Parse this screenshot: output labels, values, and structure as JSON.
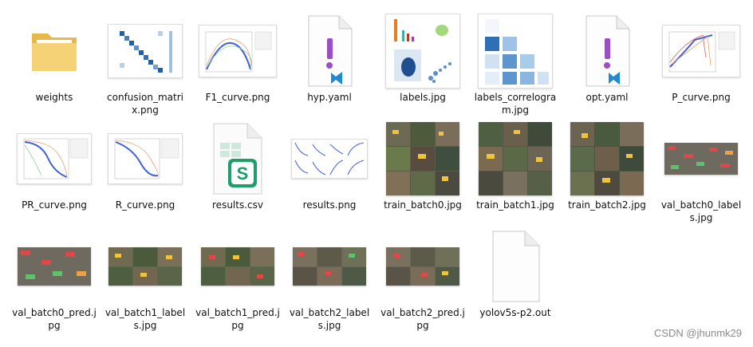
{
  "files": [
    {
      "name": "weights",
      "icon": "folder-icon"
    },
    {
      "name": "confusion_matrix.png",
      "icon": "image-thumbnail"
    },
    {
      "name": "F1_curve.png",
      "icon": "image-thumbnail"
    },
    {
      "name": "hyp.yaml",
      "icon": "vscode-file-icon"
    },
    {
      "name": "labels.jpg",
      "icon": "image-thumbnail"
    },
    {
      "name": "labels_correlogram.jpg",
      "icon": "image-thumbnail"
    },
    {
      "name": "opt.yaml",
      "icon": "vscode-file-icon"
    },
    {
      "name": "P_curve.png",
      "icon": "image-thumbnail"
    },
    {
      "name": "PR_curve.png",
      "icon": "image-thumbnail"
    },
    {
      "name": "R_curve.png",
      "icon": "image-thumbnail"
    },
    {
      "name": "results.csv",
      "icon": "spreadsheet-file-icon"
    },
    {
      "name": "results.png",
      "icon": "image-thumbnail"
    },
    {
      "name": "train_batch0.jpg",
      "icon": "image-thumbnail"
    },
    {
      "name": "train_batch1.jpg",
      "icon": "image-thumbnail"
    },
    {
      "name": "train_batch2.jpg",
      "icon": "image-thumbnail"
    },
    {
      "name": "val_batch0_labels.jpg",
      "icon": "image-thumbnail"
    },
    {
      "name": "val_batch0_pred.jpg",
      "icon": "image-thumbnail"
    },
    {
      "name": "val_batch1_labels.jpg",
      "icon": "image-thumbnail"
    },
    {
      "name": "val_batch1_pred.jpg",
      "icon": "image-thumbnail"
    },
    {
      "name": "val_batch2_labels.jpg",
      "icon": "image-thumbnail"
    },
    {
      "name": "val_batch2_pred.jpg",
      "icon": "image-thumbnail"
    },
    {
      "name": "yolov5s-p2.out",
      "icon": "blank-file-icon"
    }
  ],
  "watermark": "CSDN @jhunmk29",
  "colors": {
    "folder": "#f0c95a",
    "vscode_purple": "#9b4fc6",
    "vscode_blue": "#1f8ad2",
    "sheet_green": "#1e9e6a"
  }
}
